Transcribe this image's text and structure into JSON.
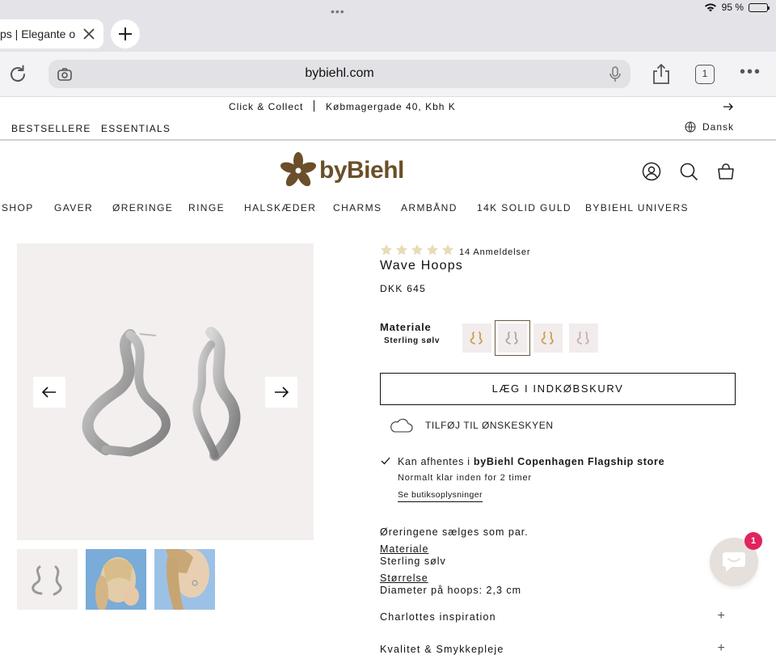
{
  "status": {
    "dots": "•••",
    "battery": "95 %",
    "battery_level": 0.95
  },
  "browser": {
    "tab_title": "ps | Elegante o",
    "url": "bybiehl.com",
    "tab_count": "1",
    "more": "•••"
  },
  "announcement": {
    "left": "Click & Collect",
    "right": "Købmagergade 40, Kbh K"
  },
  "topnav": {
    "items": [
      "BESTSELLERE",
      "ESSENTIALS"
    ],
    "language": "Dansk"
  },
  "header": {
    "logo_text": "byBiehl",
    "brand_color": "#6b4f2a"
  },
  "mainnav": [
    "SHOP",
    "GAVER",
    "ØRERINGE",
    "RINGE",
    "HALSKÆDER",
    "CHARMS",
    "ARMBÅND",
    "14K SOLID GULD",
    "BYBIEHL UNIVERS"
  ],
  "product": {
    "rating": 5,
    "reviews": "14 Anmeldelser",
    "title": "Wave Hoops",
    "price": "DKK 645",
    "material_label": "Materiale",
    "material_value": "Sterling sølv",
    "add_to_cart": "LÆG I INDKØBSKURV",
    "wishlist": "TILFØJ TIL ØNSKESKYEN",
    "pickup_prefix": "Kan afhentes i ",
    "pickup_store": "byBiehl Copenhagen Flagship store",
    "pickup_time": "Normalt klar inden for 2 timer",
    "pickup_link": "Se butiksoplysninger",
    "description": "Øreringene sælges som par.",
    "spec_material_label": "Materiale",
    "spec_material_value": "Sterling sølv",
    "spec_size_label": "Størrelse",
    "spec_size_value": "Diameter på hoops: 2,3 cm",
    "accordion": [
      "Charlottes inspiration",
      "Kvalitet & Smykkepleje"
    ],
    "swatch_colors": [
      "#c9a04a",
      "#a8a8a8",
      "#c9a04a",
      "#c4b0b0"
    ],
    "star_color": "#e8dcb4"
  },
  "chat": {
    "badge": "1"
  }
}
